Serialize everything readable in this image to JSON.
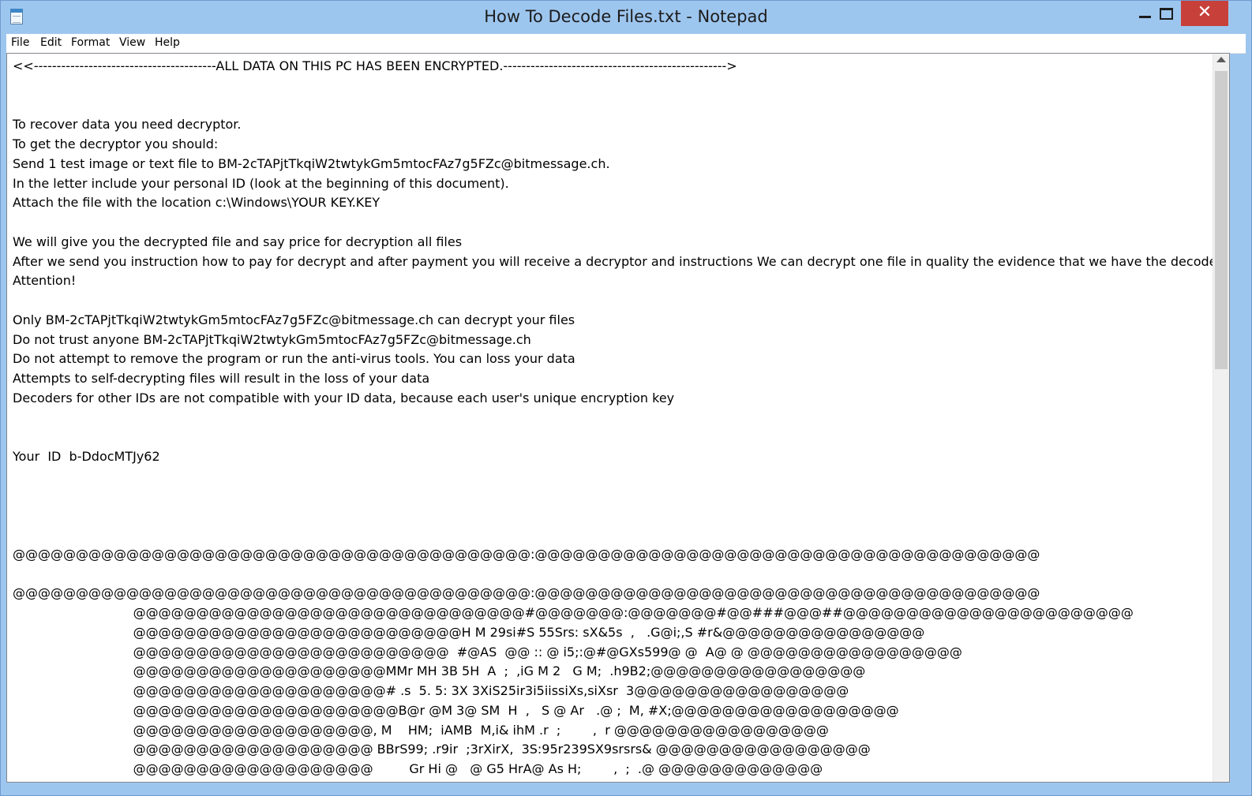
{
  "window": {
    "title": "How To Decode Files.txt - Notepad",
    "close_glyph": "✕"
  },
  "menu": [
    "File",
    "Edit",
    "Format",
    "View",
    "Help"
  ],
  "document": {
    "lines": [
      "<<----------------------------------------ALL DATA ON THIS PC HAS BEEN ENCRYPTED.------------------------------------------------->",
      "",
      "",
      "To recover data you need decryptor.",
      "To get the decryptor you should:",
      "Send 1 test image or text file to BM-2cTAPjtTkqiW2twtykGm5mtocFAz7g5FZc@bitmessage.ch.",
      "In the letter include your personal ID (look at the beginning of this document).",
      "Attach the file with the location c:\\Windows\\YOUR KEY.KEY",
      "",
      "We will give you the decrypted file and say price for decryption all files",
      "After we send you instruction how to pay for decrypt and after payment you will receive a decryptor and instructions We can decrypt one file in quality the evidence that we have the decoder.",
      "Attention!",
      "",
      "Only BM-2cTAPjtTkqiW2twtykGm5mtocFAz7g5FZc@bitmessage.ch can decrypt your files",
      "Do not trust anyone BM-2cTAPjtTkqiW2twtykGm5mtocFAz7g5FZc@bitmessage.ch",
      "Do not attempt to remove the program or run the anti-virus tools. You can loss your data",
      "Attempts to self-decrypting files will result in the loss of your data",
      "Decoders for other IDs are not compatible with your ID data, because each user's unique encryption key",
      "",
      "",
      "Your  ID  b-DdocMTJy62",
      "",
      "",
      "",
      "",
      "@@@@@@@@@@@@@@@@@@@@@@@@@@@@@@@@@@@@@@@@@:@@@@@@@@@@@@@@@@@@@@@@@@@@@@@@@@@@@@@@@@",
      "",
      "@@@@@@@@@@@@@@@@@@@@@@@@@@@@@@@@@@@@@@@@@:@@@@@@@@@@@@@@@@@@@@@@@@@@@@@@@@@@@@@@@@",
      "                              @@@@@@@@@@@@@@@@@@@@@@@@@@@@@@@#@@@@@@@:@@@@@@@#@@###@@@##@@@@@@@@@@@@@@@@@@@@@@@",
      "                              @@@@@@@@@@@@@@@@@@@@@@@@@@H M 29si#S 55Srs: sX&5s  ,   .G@i;,S #r&@@@@@@@@@@@@@@@@",
      "                              @@@@@@@@@@@@@@@@@@@@@@@@@  #@AS  @@ :: @ i5;:@#@GXs599@ @  A@ @ @@@@@@@@@@@@@@@@@",
      "                              @@@@@@@@@@@@@@@@@@@@MMr MH 3B 5H  A  ;  ,iG M 2   G M;  .h9B2;@@@@@@@@@@@@@@@@@",
      "                              @@@@@@@@@@@@@@@@@@@@# .s  5. 5: 3X 3XiS25ir3i5iissiXs,siXsr  3@@@@@@@@@@@@@@@@@",
      "                              @@@@@@@@@@@@@@@@@@@@@B@r @M 3@ SM  H  ,   S @ Ar   .@ ;  M, #X;@@@@@@@@@@@@@@@@@@",
      "                              @@@@@@@@@@@@@@@@@@@, M    HM;  iAMB  M,i& ihM .r  ;        ,  r @@@@@@@@@@@@@@@@@",
      "                              @@@@@@@@@@@@@@@@@@@ BBrS99; .r9ir  ;3rXirX,  3S:95r239SX9srsrs& @@@@@@@@@@@@@@@@@",
      "                              @@@@@@@@@@@@@@@@@@@         Gr Hi @   @ G5 HrA@ As H;        ,  ;  .@ @@@@@@@@@@@@@"
    ]
  }
}
